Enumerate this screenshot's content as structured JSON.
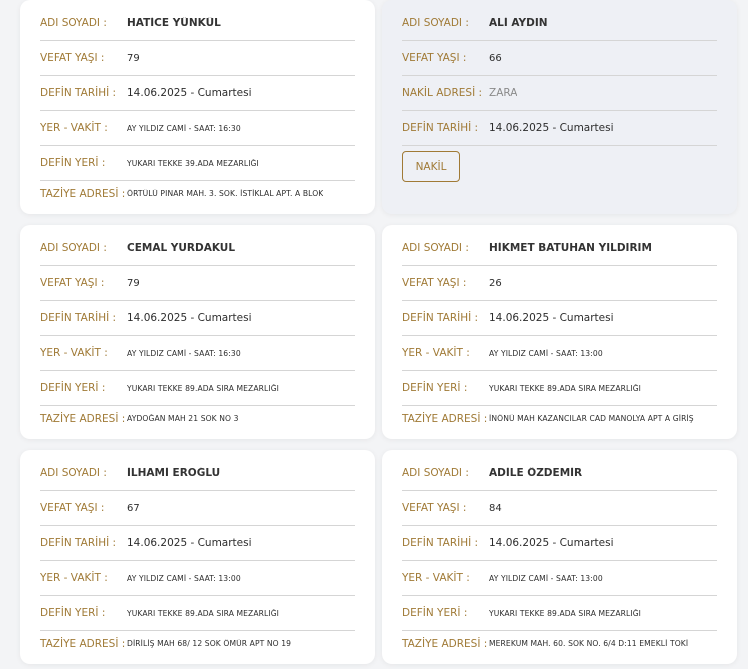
{
  "labels": {
    "name": "ADI SOYADI :",
    "age": "VEFAT YAŞI :",
    "burial_date": "DEFİN TARİHİ :",
    "place_time": "YER - VAKİT :",
    "burial_place": "DEFİN YERİ :",
    "condolence": "TAZİYE ADRESİ :",
    "transfer": "NAKİL ADRESİ :",
    "transfer_button": "NAKİL"
  },
  "cards": [
    {
      "name": "HATİCE YÜNKÜL",
      "age": "79",
      "burial_date": "14.06.2025 - Cumartesi",
      "place_time": "AY YILDIZ CAMİ - SAAT: 16:30",
      "burial_place": "YUKARI TEKKE 39.ADA MEZARLIĞI",
      "condolence": "ÖRTÜLÜ PINAR MAH. 3. SOK. İSTİKLAL APT. A BLOK"
    },
    {
      "name": "ALİ AYDIN",
      "age": "66",
      "transfer_address": "ZARA",
      "burial_date": "14.06.2025 - Cumartesi"
    },
    {
      "name": "CEMAL YURDAKUL",
      "age": "79",
      "burial_date": "14.06.2025 - Cumartesi",
      "place_time": "AY YILDIZ CAMİ - SAAT: 16:30",
      "burial_place": "YUKARI TEKKE 89.ADA SIRA MEZARLIĞI",
      "condolence": "AYDOĞAN MAH 21 SOK NO 3"
    },
    {
      "name": "HİKMET BATUHAN YILDIRIM",
      "age": "26",
      "burial_date": "14.06.2025 - Cumartesi",
      "place_time": "AY YILDIZ CAMİ - SAAT: 13:00",
      "burial_place": "YUKARI TEKKE 89.ADA SIRA MEZARLIĞI",
      "condolence": "İNÖNÜ MAH KAZANCILAR CAD MANOLYA APT A GİRİŞ"
    },
    {
      "name": "İLHAMİ EROĞLU",
      "age": "67",
      "burial_date": "14.06.2025 - Cumartesi",
      "place_time": "AY YILDIZ CAMİ - SAAT: 13:00",
      "burial_place": "YUKARI TEKKE 89.ADA SIRA MEZARLIĞI",
      "condolence": "DİRİLİŞ MAH 68/ 12 SOK ÖMÜR APT NO 19"
    },
    {
      "name": "ADİLE ÖZDEMİR",
      "age": "84",
      "burial_date": "14.06.2025 - Cumartesi",
      "place_time": "AY YILDIZ CAMİ - SAAT: 13:00",
      "burial_place": "YUKARI TEKKE 89.ADA SIRA MEZARLIĞI",
      "condolence": "MEREKUM MAH. 60. SOK NO. 6/4 D:11 EMEKLİ TOKİ"
    }
  ],
  "colors": {
    "label": "#a07a36",
    "value": "#2d2d2d",
    "card_bg": "#ffffff",
    "card_highlight_bg": "#eef0f5",
    "page_bg": "#f3f4f6"
  }
}
